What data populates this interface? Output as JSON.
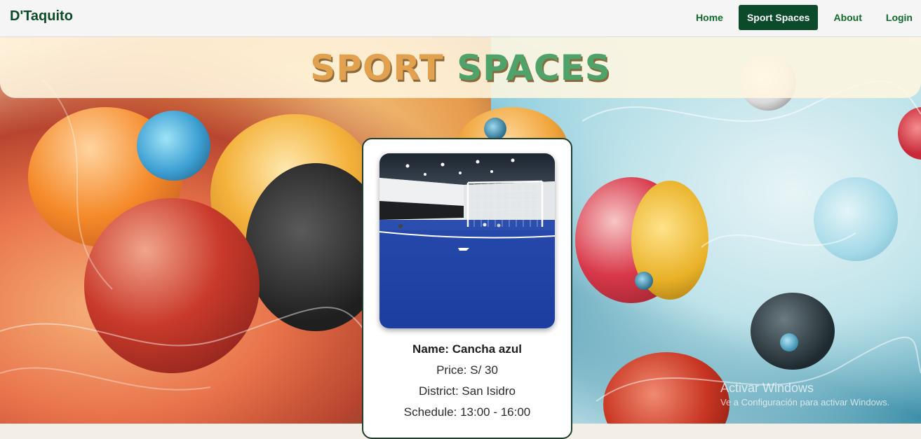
{
  "app": {
    "brand": "D'Taquito"
  },
  "nav": {
    "items": [
      {
        "label": "Home",
        "active": false
      },
      {
        "label": "Sport Spaces",
        "active": true
      },
      {
        "label": "About",
        "active": false
      },
      {
        "label": "Login",
        "active": false
      }
    ]
  },
  "hero": {
    "title_word1": "SPORT",
    "title_word2": "SPACES"
  },
  "card": {
    "image_icon": "indoor-soccer-field-photo",
    "name": "Name: Cancha azul",
    "price": "Price: S/ 30",
    "district": "District: San Isidro",
    "schedule": "Schedule: 13:00 - 16:00"
  },
  "watermark": {
    "title": "Activar Windows",
    "subtitle": "Ve a Configuración para activar Windows."
  },
  "colors": {
    "brand_green": "#0b4a2a",
    "nav_text_green": "#0e6b2a",
    "card_border": "#1f3d2c"
  }
}
